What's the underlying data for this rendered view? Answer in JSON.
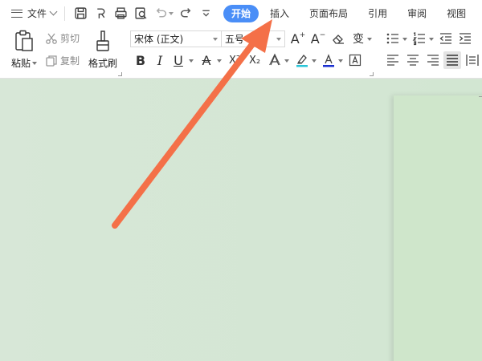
{
  "menubar": {
    "file_label": "文件",
    "tabs": [
      {
        "label": "开始",
        "active": true
      },
      {
        "label": "插入",
        "active": false
      },
      {
        "label": "页面布局",
        "active": false
      },
      {
        "label": "引用",
        "active": false
      },
      {
        "label": "审阅",
        "active": false
      },
      {
        "label": "视图",
        "active": false
      }
    ]
  },
  "ribbon": {
    "paste_label": "粘贴",
    "cut_label": "剪切",
    "copy_label": "复制",
    "format_painter_label": "格式刷",
    "font_name": "宋体 (正文)",
    "font_size": "五号",
    "bold_glyph": "B",
    "italic_glyph": "I",
    "underline_glyph": "U",
    "strike_glyph": "A",
    "superscript_glyph": "X²",
    "subscript_glyph": "X₂",
    "grow_glyph": "A",
    "shrink_glyph": "A",
    "pinyin_glyph": "变",
    "effects_glyph": "A",
    "font_color_glyph": "A",
    "char_border_glyph": "A"
  },
  "colors": {
    "accent": "#4a8ef7",
    "arrow": "#f47048",
    "highlight": "#29c5d8",
    "font_color": "#1a2fd0",
    "doc_background": "#d6e6d6"
  }
}
